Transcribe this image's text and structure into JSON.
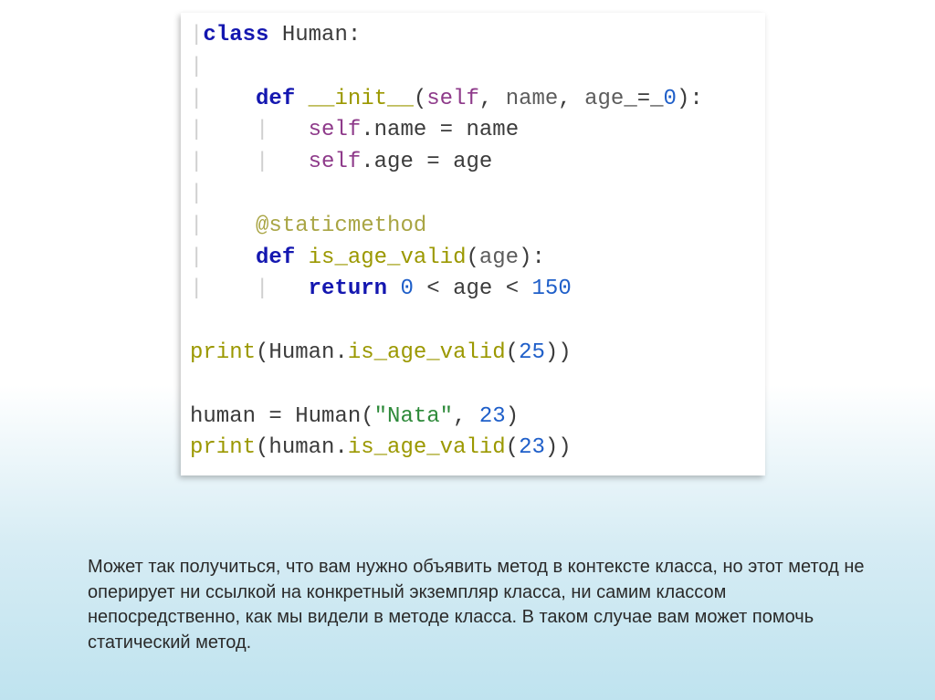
{
  "code": {
    "kw_class": "class",
    "cls_name": "Human",
    "kw_def": "def",
    "init_name": "__init__",
    "self": "self",
    "p_name": "name",
    "p_age": "age",
    "zero": "0",
    "assign_name_lhs": "name",
    "assign_name_rhs": "name",
    "assign_age_lhs": "age",
    "assign_age_rhs": "age",
    "decorator": "@staticmethod",
    "fn_is_age_valid": "is_age_valid",
    "kw_return": "return",
    "lt1_left": "0",
    "lt1_mid": "age",
    "lt1_right": "150",
    "print1_fn": "print",
    "print1_call": "is_age_valid",
    "print1_arg": "25",
    "inst_var": "human",
    "inst_call_cls": "Human",
    "inst_arg_str": "\"Nata\"",
    "inst_arg_num": "23",
    "print2_fn": "print",
    "print2_recv": "human",
    "print2_call": "is_age_valid",
    "print2_arg": "23"
  },
  "caption": " Может так получиться, что вам нужно объявить метод в контексте класса, но этот метод не оперирует ни ссылкой на конкретный экземпляр класса, ни самим классом непосредственно, как мы видели в методе класса. В таком случае вам может помочь статический метод."
}
